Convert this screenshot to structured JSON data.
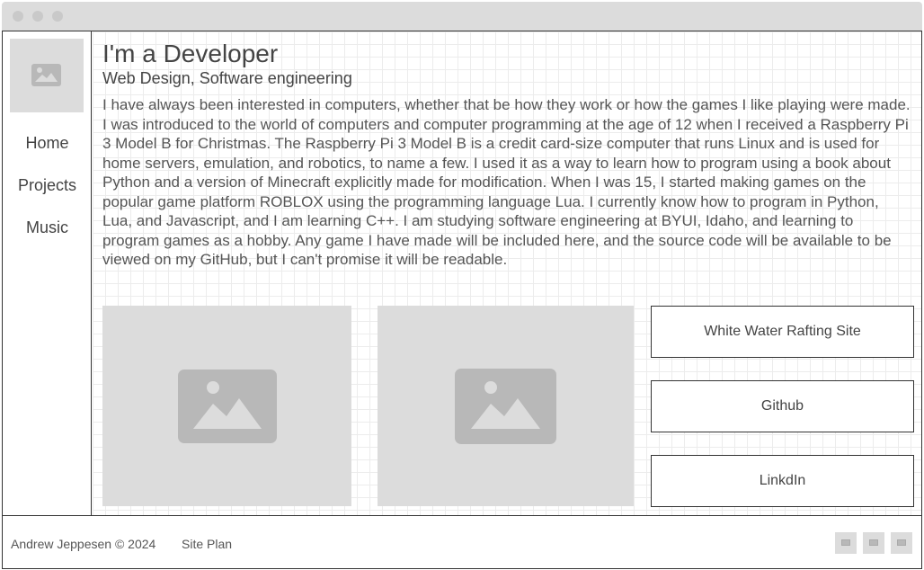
{
  "window": {
    "controls": [
      "close-dot",
      "minimize-dot",
      "maximize-dot"
    ]
  },
  "sidebar": {
    "logo_icon": "image-placeholder-icon",
    "items": [
      {
        "label": "Home"
      },
      {
        "label": "Projects"
      },
      {
        "label": "Music"
      }
    ]
  },
  "main": {
    "title": "I'm a Developer",
    "subtitle": "Web Design, Software engineering",
    "bio": "I have always been interested in computers, whether that be how they work or how the games I like playing were made. I was introduced to the world of computers and computer programming at the age of 12 when I received a Raspberry Pi 3 Model B for Christmas. The Raspberry Pi 3 Model B is a credit card-size computer that runs Linux and is used for home servers, emulation, and robotics, to name a few. I used it as a way to learn how to program using a book about Python and a version of Minecraft explicitly made for modification. When I was 15, I started making games on the popular game platform ROBLOX using the programming language Lua. I currently know how to program in Python, Lua, and Javascript, and I am learning C++. I am studying software engineering at BYUI, Idaho, and learning to program games as a hobby. Any game I have made will be included here, and the source code will be available to be viewed on my GitHub, but I can't promise it will be readable.",
    "images": [
      "image-placeholder-icon",
      "image-placeholder-icon"
    ],
    "links": [
      {
        "label": "White Water Rafting Site"
      },
      {
        "label": "Github"
      },
      {
        "label": "LinkdIn"
      }
    ]
  },
  "footer": {
    "copyright": "Andrew Jeppesen © 2024",
    "site_plan": "Site Plan",
    "social_icons": [
      "social-icon",
      "social-icon",
      "social-icon"
    ]
  },
  "colors": {
    "placeholder": "#dcdcdc",
    "placeholder_glyph": "#b8b8b8",
    "border": "#333333",
    "text": "#444444",
    "grid": "#ececec"
  }
}
